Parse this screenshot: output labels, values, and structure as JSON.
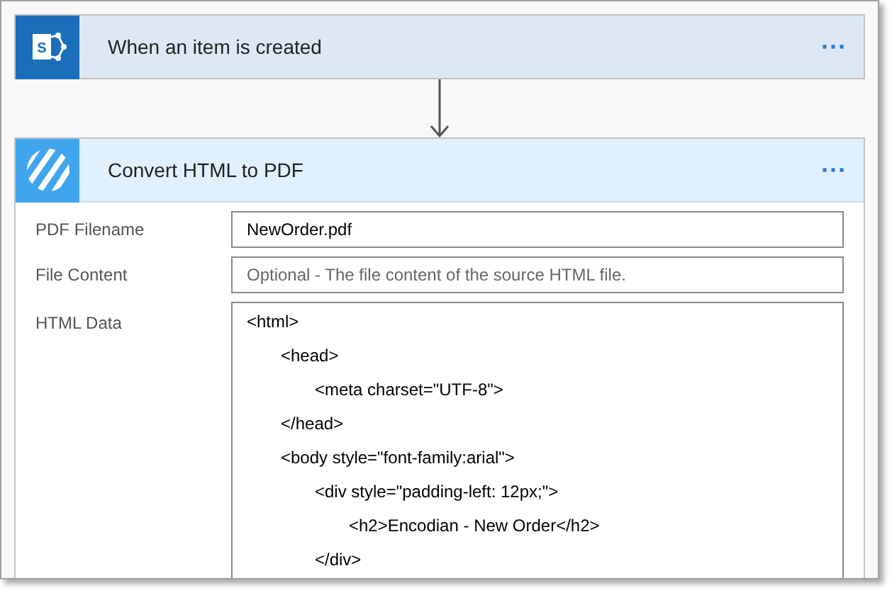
{
  "trigger": {
    "icon_text": "S",
    "title": "When an item is created",
    "menu": "···"
  },
  "action": {
    "title": "Convert HTML to PDF",
    "menu": "···",
    "fields": [
      {
        "label": "PDF Filename",
        "value": "NewOrder.pdf"
      },
      {
        "label": "File Content",
        "placeholder": "Optional - The file content of the source HTML file."
      }
    ],
    "html_data": {
      "label": "HTML Data",
      "lines": [
        {
          "text": "<html>",
          "children": [
            {
              "text": "<head>",
              "children": [
                {
                  "text": "<meta charset=\"UTF-8\">"
                }
              ]
            },
            {
              "text": "</head>"
            },
            {
              "text": "<body style=\"font-family:arial\">",
              "children": [
                {
                  "text": "<div style=\"padding-left: 12px;\">",
                  "children": [
                    {
                      "text": "<h2>Encodian - New Order</h2>"
                    }
                  ]
                },
                {
                  "text": "</div>"
                }
              ]
            }
          ]
        }
      ]
    }
  }
}
